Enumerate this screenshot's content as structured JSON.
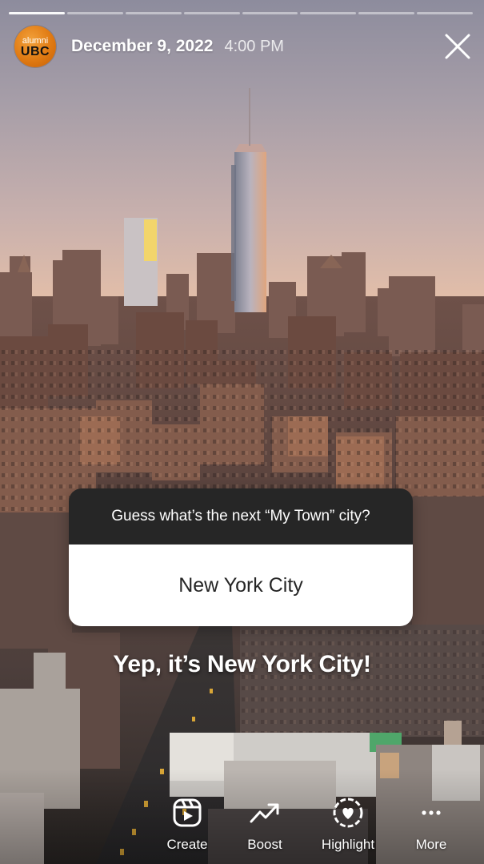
{
  "story": {
    "account": {
      "avatar_line1": "alumni",
      "avatar_line2": "UBC"
    },
    "date": "December 9, 2022",
    "time": "4:00 PM",
    "progress": {
      "segments": 8,
      "current": 1
    }
  },
  "question_sticker": {
    "question": "Guess what’s the next “My Town” city?",
    "answer": "New York City"
  },
  "caption": "Yep, it’s New York City!",
  "actions": [
    {
      "label": "Create",
      "icon": "reel-create-icon"
    },
    {
      "label": "Boost",
      "icon": "trending-up-icon"
    },
    {
      "label": "Highlight",
      "icon": "heart-circle-icon"
    },
    {
      "label": "More",
      "icon": "more-dots-icon"
    }
  ]
}
